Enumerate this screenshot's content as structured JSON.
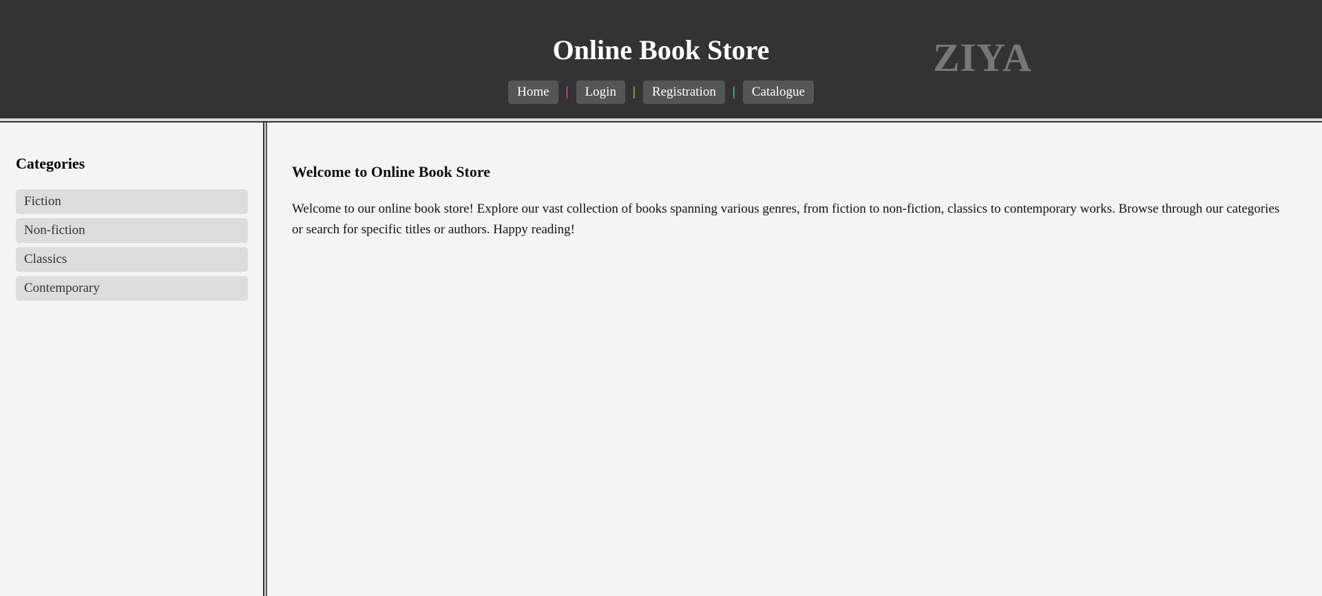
{
  "header": {
    "title": "Online Book Store",
    "logo_text": "ZIYA",
    "nav": [
      {
        "label": "Home"
      },
      {
        "label": "Login"
      },
      {
        "label": "Registration"
      },
      {
        "label": "Catalogue"
      }
    ],
    "separator": "|",
    "separator_colors": [
      "#ff66cc",
      "#ffee55",
      "#66ffee"
    ]
  },
  "sidebar": {
    "heading": "Categories",
    "items": [
      {
        "label": "Fiction"
      },
      {
        "label": "Non-fiction"
      },
      {
        "label": "Classics"
      },
      {
        "label": "Contemporary"
      }
    ]
  },
  "main": {
    "heading": "Welcome to Online Book Store",
    "text": "Welcome to our online book store! Explore our vast collection of books spanning various genres, from fiction to non-fiction, classics to contemporary works. Browse through our categories or search for specific titles or authors. Happy reading!"
  },
  "colors": {
    "header_bg": "#333333",
    "nav_button_bg": "#555555",
    "page_bg": "#f4f4f4",
    "category_bg": "#dddddd"
  }
}
